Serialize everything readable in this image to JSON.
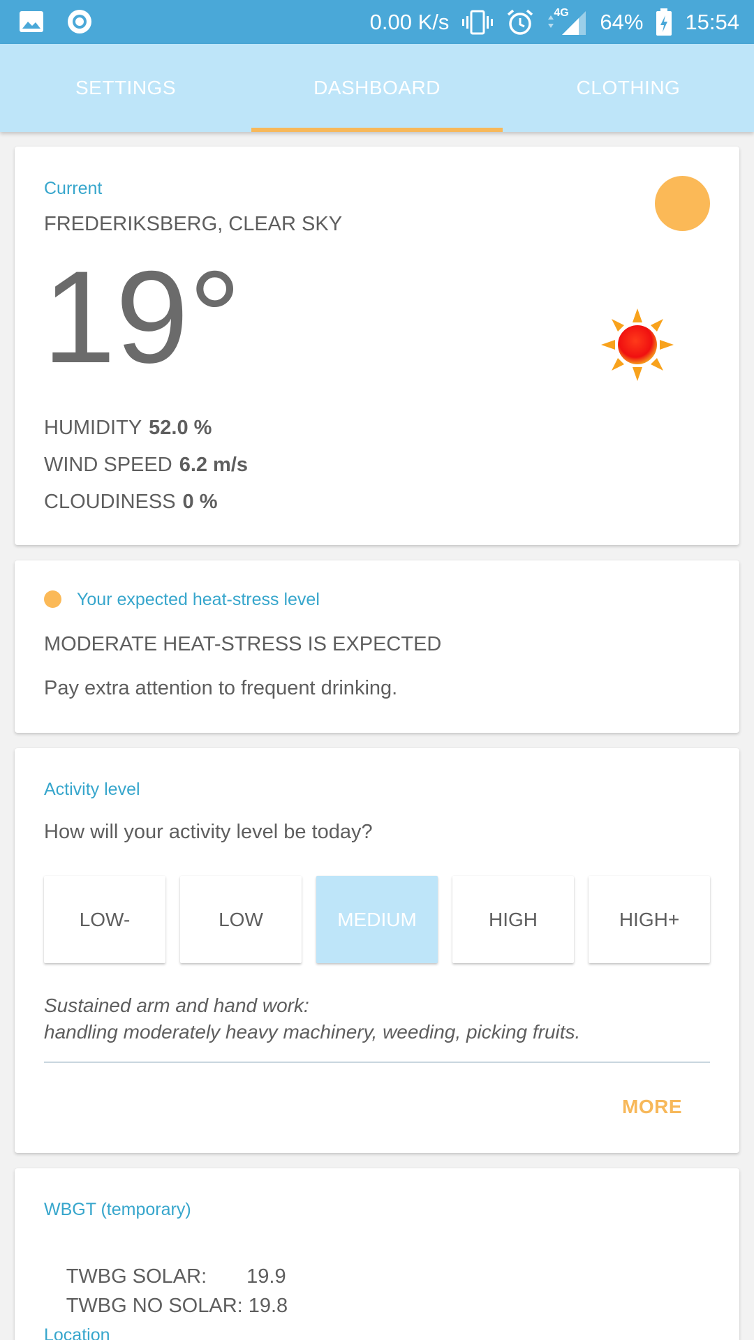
{
  "status_bar": {
    "speed": "0.00 K/s",
    "network": "4G",
    "battery": "64%",
    "time": "15:54",
    "icons": [
      "image-icon",
      "circle-app-icon",
      "vibrate-icon",
      "alarm-icon",
      "signal-icon",
      "battery-charging-icon"
    ]
  },
  "tabs": [
    {
      "label": "SETTINGS",
      "selected": false
    },
    {
      "label": "DASHBOARD",
      "selected": true
    },
    {
      "label": "CLOTHING",
      "selected": false
    }
  ],
  "weather": {
    "section_label": "Current",
    "location": "FREDERIKSBERG, CLEAR SKY",
    "temperature": "19°",
    "icon": "sun-icon",
    "humidity_label": "HUMIDITY",
    "humidity_value": "52.0 %",
    "wind_label": "WIND SPEED",
    "wind_value": "6.2 m/s",
    "cloud_label": "CLOUDINESS",
    "cloud_value": "0 %"
  },
  "heat_stress": {
    "section_label": "Your expected heat-stress level",
    "headline": "MODERATE HEAT-STRESS IS EXPECTED",
    "advice": "Pay extra attention to frequent drinking."
  },
  "activity": {
    "section_label": "Activity level",
    "question": "How will your activity level be today?",
    "levels": [
      "LOW-",
      "LOW",
      "MEDIUM",
      "HIGH",
      "HIGH+"
    ],
    "selected_level": "MEDIUM",
    "description_line1": "Sustained arm and hand work:",
    "description_line2": "handling moderately heavy machinery, weeding, picking fruits.",
    "more_label": "MORE"
  },
  "wbgt": {
    "section_label": "WBGT (temporary)",
    "solar_label": "TWBG SOLAR:",
    "solar_value": "19.9",
    "nosolar_label": "TWBG NO SOLAR:",
    "nosolar_value": "19.8",
    "next_label": "Location"
  },
  "colors": {
    "status_bar": "#4aa8d8",
    "tab_bar": "#bee5f9",
    "accent_orange": "#f7b85a",
    "label_blue": "#37a6cc"
  }
}
